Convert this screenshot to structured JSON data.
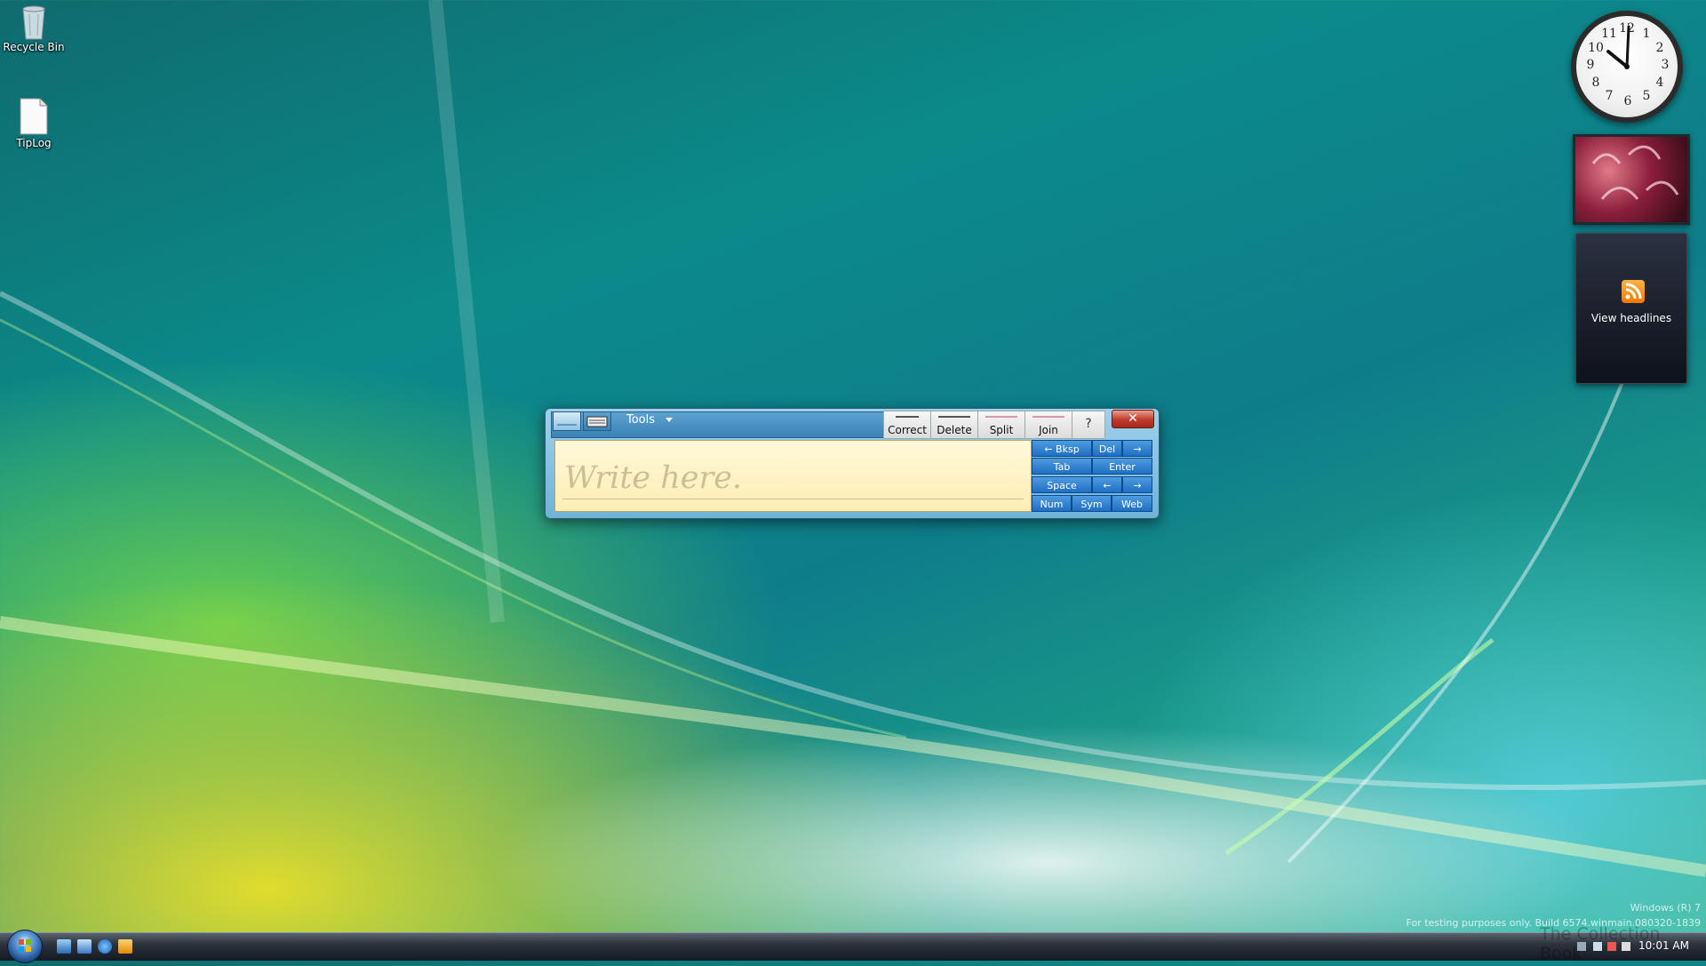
{
  "desktop": {
    "icons": [
      {
        "label": "Recycle Bin",
        "icon": "recycle-bin-icon"
      },
      {
        "label": "TipLog",
        "icon": "text-file-icon"
      }
    ]
  },
  "gadgets": {
    "clock": {
      "time": "10:01",
      "numerals": [
        "12",
        "1",
        "2",
        "3",
        "4",
        "5",
        "6",
        "7",
        "8",
        "9",
        "10",
        "11"
      ]
    },
    "feed": {
      "label": "View headlines",
      "icon": "rss-icon"
    },
    "slideshow": {
      "icon": "photo-slideshow-icon"
    }
  },
  "input_panel": {
    "tools_label": "Tools",
    "gestures": [
      "Correct",
      "Delete",
      "Split",
      "Join"
    ],
    "write_hint": "Write here.",
    "close_glyph": "✕",
    "help_glyph": "?",
    "keys": {
      "back": "← Bksp",
      "del": "Del",
      "del_arrow": "→",
      "tab": "Tab",
      "enter": "Enter",
      "space": "Space",
      "left": "←",
      "right": "→",
      "num": "Num",
      "sym": "Sym",
      "web": "Web"
    }
  },
  "taskbar": {
    "time": "10:01 AM",
    "quick_launch": [
      "show-desktop-icon",
      "switch-windows-icon",
      "internet-explorer-icon",
      "media-player-icon"
    ]
  },
  "watermark": {
    "line1": "Windows (R) 7",
    "line2": "For testing purposes only. Build 6574.winmain.080320-1839",
    "collection": "The Collection Book"
  },
  "colors": {
    "accent": "#1f6fc4",
    "close": "#c0392b"
  }
}
